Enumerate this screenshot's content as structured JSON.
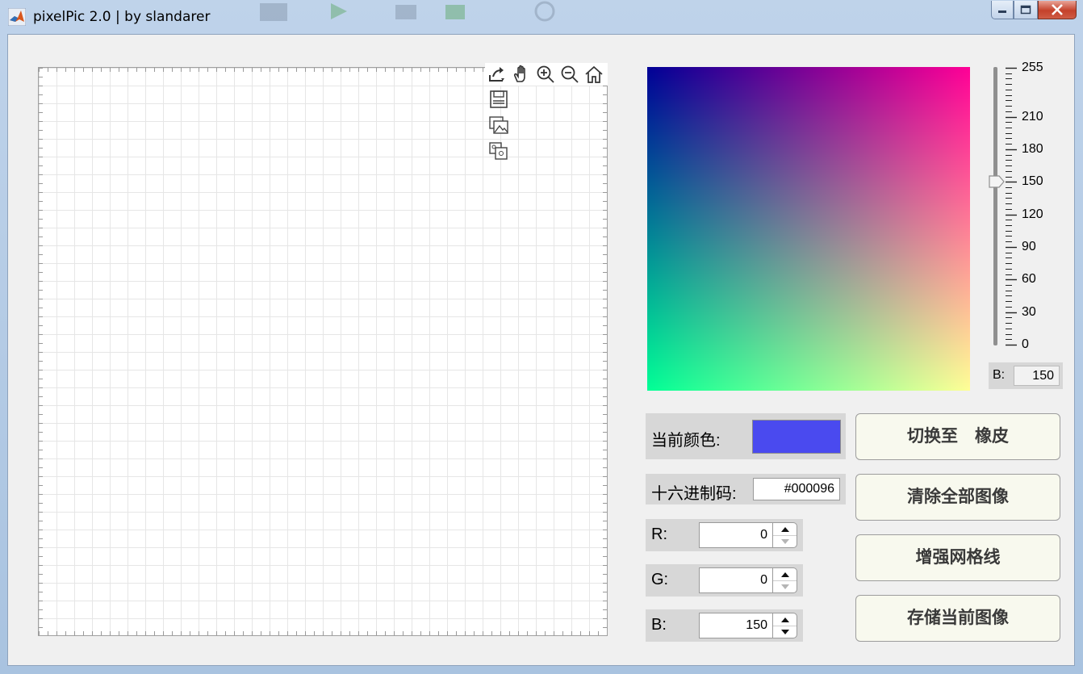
{
  "window": {
    "title": "pixelPic 2.0 | by slandarer",
    "controls": [
      "minimize",
      "maximize",
      "close"
    ]
  },
  "axes": {
    "toolbar": [
      "export-icon",
      "pan-hand-icon",
      "zoom-in-icon",
      "zoom-out-icon",
      "home-icon"
    ],
    "toolbar_vertical": [
      "save-icon",
      "image-icon",
      "copy-image-icon"
    ]
  },
  "color_picker": {
    "gradient": {
      "top_left": "#000096",
      "top_right": "#ff0096",
      "bottom_left": "#00ff96",
      "bottom_right": "#ffff96"
    },
    "slider": {
      "value": 150,
      "min": 0,
      "max": 255,
      "ticks": [
        "255",
        "210",
        "180",
        "150",
        "120",
        "90",
        "60",
        "30",
        "0"
      ]
    },
    "b_label": "B:",
    "b_value": "150"
  },
  "current_color": {
    "label": "当前颜色:",
    "swatch": "#4a4aef"
  },
  "hex": {
    "label": "十六进制码:",
    "value": "#000096"
  },
  "rgb": [
    {
      "label": "R:",
      "value": "0"
    },
    {
      "label": "G:",
      "value": "0"
    },
    {
      "label": "B:",
      "value": "150"
    }
  ],
  "buttons": {
    "toggle": "切换至　橡皮",
    "clear": "清除全部图像",
    "grid": "增强网格线",
    "save": "存储当前图像"
  }
}
